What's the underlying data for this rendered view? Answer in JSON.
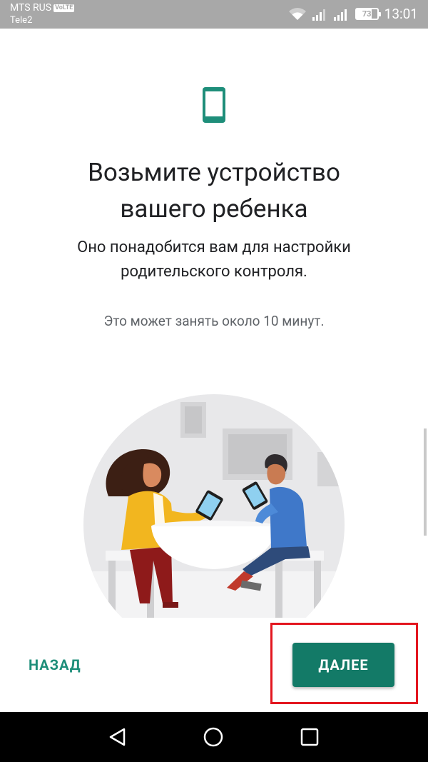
{
  "status_bar": {
    "carrier_primary": "MTS RUS",
    "volte_badge": "VoLTE",
    "carrier_secondary": "Tele2",
    "battery_percent": "73",
    "time": "13:01",
    "icons": [
      "wifi-icon",
      "signal-icon",
      "signal-icon",
      "battery-icon"
    ]
  },
  "main": {
    "icon": "smartphone-icon",
    "title_line1": "Возьмите устройство",
    "title_line2": "вашего ребенка",
    "subtitle_line1": "Оно понадобится вам для настройки",
    "subtitle_line2": "родительского контроля.",
    "note": "Это может занять около 10 минут."
  },
  "footer": {
    "back_label": "НАЗАД",
    "next_label": "ДАЛЕЕ"
  },
  "nav_bar": {
    "icons": [
      "back-triangle-icon",
      "home-circle-icon",
      "recents-square-icon"
    ]
  },
  "colors": {
    "accent": "#137a67",
    "link": "#1e8e7a",
    "highlight": "#e3161f",
    "status_bar": "#a8a8a8"
  }
}
